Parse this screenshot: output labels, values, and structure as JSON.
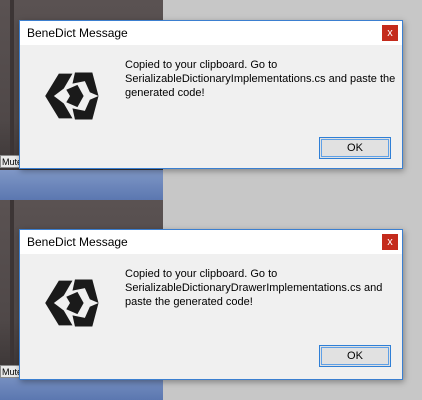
{
  "background": {
    "mute_label_top": "Mute",
    "mute_label_bottom": "Mute"
  },
  "dialogs": [
    {
      "title": "BeneDict Message",
      "close_glyph": "x",
      "message": "Copied to your clipboard. Go to SerializableDictionaryImplementations.cs and paste the generated code!",
      "ok_label": "OK"
    },
    {
      "title": "BeneDict Message",
      "close_glyph": "x",
      "message": "Copied to your clipboard. Go to SerializableDictionaryDrawerImplementations.cs and paste the generated code!",
      "ok_label": "OK"
    }
  ],
  "colors": {
    "close_button": "#c42b1c",
    "ok_border": "#2f7fd6",
    "dialog_border": "#3b7fd0"
  }
}
